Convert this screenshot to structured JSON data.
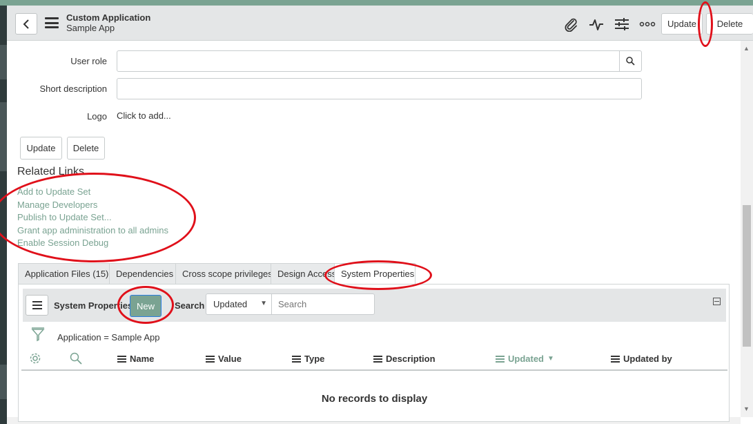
{
  "header": {
    "title": "Custom Application",
    "subtitle": "Sample App",
    "update_label": "Update",
    "delete_label": "Delete"
  },
  "form": {
    "user_role_label": "User role",
    "short_description_label": "Short description",
    "logo_label": "Logo",
    "logo_value": "Click to add...",
    "user_role_value": "",
    "short_description_value": ""
  },
  "form_buttons": {
    "update_label": "Update",
    "delete_label": "Delete"
  },
  "related_links": {
    "title": "Related Links",
    "items": [
      "Add to Update Set",
      "Manage Developers",
      "Publish to Update Set...",
      "Grant app administration to all admins",
      "Enable Session Debug"
    ]
  },
  "tabs": [
    "Application Files (15)",
    "Dependencies",
    "Cross scope privileges",
    "Design Access",
    "System Properties"
  ],
  "list": {
    "title": "System Properties",
    "new_label": "New",
    "search_label": "Search",
    "search_field": "Updated",
    "search_placeholder": "Search",
    "filter": "Application = Sample App",
    "columns": [
      "Name",
      "Value",
      "Type",
      "Description",
      "Updated",
      "Updated by"
    ],
    "sorted_column": "Updated",
    "empty_message": "No records to display"
  },
  "colors": {
    "accent": "#7aa392",
    "annotation": "#e0101a"
  }
}
